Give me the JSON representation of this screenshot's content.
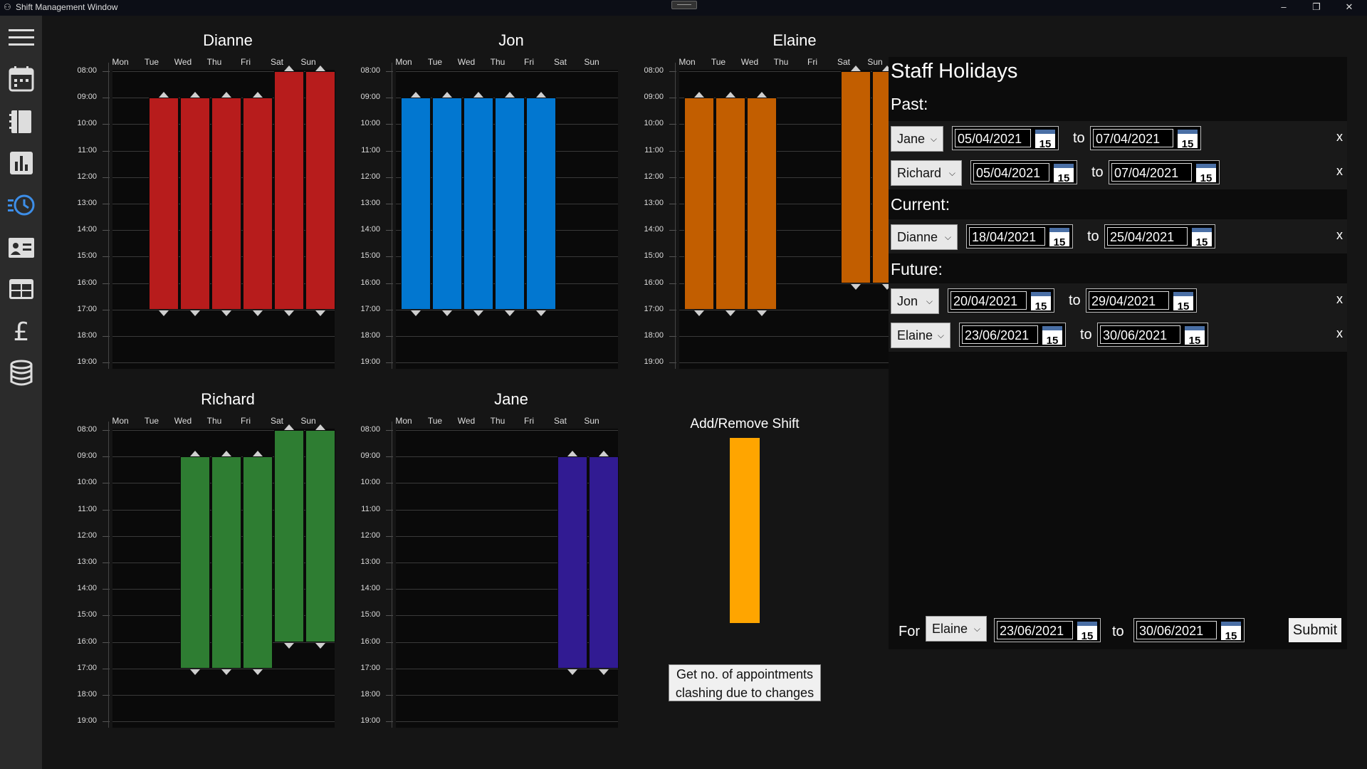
{
  "window": {
    "title": "Shift Management Window",
    "minimize": "–",
    "restore": "❐",
    "close": "✕"
  },
  "sidebar": {
    "items": [
      {
        "icon": "hamburger-menu-icon"
      },
      {
        "icon": "calendar-icon"
      },
      {
        "icon": "notebook-icon"
      },
      {
        "icon": "bar-chart-icon"
      },
      {
        "icon": "clock-icon",
        "active": true
      },
      {
        "icon": "contact-card-icon"
      },
      {
        "icon": "table-icon"
      },
      {
        "icon": "pound-icon"
      },
      {
        "icon": "database-icon"
      }
    ]
  },
  "days": [
    "Mon",
    "Tue",
    "Wed",
    "Thu",
    "Fri",
    "Sat",
    "Sun"
  ],
  "hours": [
    "08:00",
    "09:00",
    "10:00",
    "11:00",
    "12:00",
    "13:00",
    "14:00",
    "15:00",
    "16:00",
    "17:00",
    "18:00",
    "19:00"
  ],
  "staff_charts": [
    {
      "name": "Dianne",
      "color": "#b71c1c",
      "shifts": [
        null,
        [
          9,
          17
        ],
        [
          9,
          17
        ],
        [
          9,
          17
        ],
        [
          9,
          17
        ],
        [
          8,
          17
        ],
        [
          8,
          17
        ]
      ]
    },
    {
      "name": "Jon",
      "color": "#0277d0",
      "shifts": [
        [
          9,
          17
        ],
        [
          9,
          17
        ],
        [
          9,
          17
        ],
        [
          9,
          17
        ],
        [
          9,
          17
        ],
        null,
        null
      ]
    },
    {
      "name": "Elaine",
      "color": "#c25e00",
      "shifts": [
        [
          9,
          17
        ],
        [
          9,
          17
        ],
        [
          9,
          17
        ],
        null,
        null,
        [
          8,
          16
        ],
        [
          8,
          16
        ]
      ]
    },
    {
      "name": "Richard",
      "color": "#2e7d32",
      "shifts": [
        null,
        null,
        [
          9,
          17
        ],
        [
          9,
          17
        ],
        [
          9,
          17
        ],
        [
          8,
          16
        ],
        [
          8,
          16
        ]
      ]
    },
    {
      "name": "Jane",
      "color": "#311b92",
      "shifts": [
        null,
        null,
        null,
        null,
        null,
        [
          9,
          17
        ],
        [
          9,
          17
        ]
      ]
    }
  ],
  "add_remove": {
    "title": "Add/Remove Shift",
    "color": "#ffa500",
    "clash_button": [
      "Get no. of appointments",
      "clashing due to changes"
    ]
  },
  "holidays": {
    "title": "Staff Holidays",
    "to": "to",
    "remove": "x",
    "past_label": "Past:",
    "current_label": "Current:",
    "future_label": "Future:",
    "past": [
      {
        "staff": "Jane",
        "from": "05/04/2021",
        "until": "07/04/2021"
      },
      {
        "staff": "Richard",
        "from": "05/04/2021",
        "until": "07/04/2021"
      }
    ],
    "current": [
      {
        "staff": "Dianne",
        "from": "18/04/2021",
        "until": "25/04/2021"
      }
    ],
    "future": [
      {
        "staff": "Jon",
        "from": "20/04/2021",
        "until": "29/04/2021"
      },
      {
        "staff": "Elaine",
        "from": "23/06/2021",
        "until": "30/06/2021"
      }
    ],
    "new_entry": {
      "for_label": "For",
      "staff": "Elaine",
      "from": "23/06/2021",
      "until": "30/06/2021",
      "submit": "Submit"
    },
    "calendar_glyph": "15"
  }
}
